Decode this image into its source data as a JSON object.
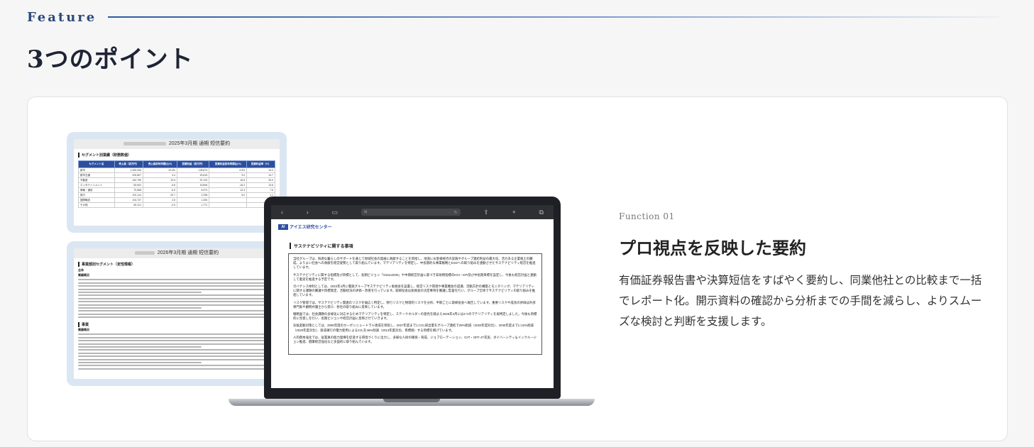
{
  "header": {
    "eyebrow": "Feature",
    "title": "3つのポイント"
  },
  "function": {
    "label": "Function 01",
    "title": "プロ視点を反映した要約",
    "description": "有価証券報告書や決算短信をすばやく要約し、同業他社との比較まで一括でレポート化。開示資料の確認から分析までの手間を減らし、よりスムーズな検討と判断を支援します。"
  },
  "doc_one": {
    "heading": "2025年3月期 通期 短信要約",
    "section": "セグメント別業績（財務数値）",
    "columns": [
      "セグメント名",
      "売上高（百万円）",
      "売上高前年同期比(%)",
      "営業利益（百万円）",
      "営業利益前年同期比(%)",
      "営業利益率（%）"
    ],
    "rows": [
      [
        "都市",
        "1,300,006",
        "10.9%",
        "128,879",
        "4.9%",
        "19.0"
      ],
      [
        "都市交通",
        "209,807",
        "3.4",
        "20,615",
        "3.0",
        "14.7"
      ],
      [
        "不動産",
        "162,799",
        "10.5",
        "57,129",
        "16.6",
        "25.0"
      ],
      [
        "エンタテインメント",
        "83,902",
        "-9.8",
        "15,896",
        "-16.2",
        "13.8"
      ],
      [
        "情報・通信",
        "70,668",
        "-6.9",
        "6,974",
        "12.3",
        "7.6"
      ],
      [
        "旅行",
        "201,114",
        "20.7",
        "2,298",
        "5.0",
        "1.1"
      ],
      [
        "国際輸送",
        "104,737",
        "2.6",
        "1,254",
        "",
        "1.2"
      ],
      [
        "その他",
        "60,121",
        "-0.9",
        "1,771",
        "",
        "2.9"
      ]
    ]
  },
  "doc_two": {
    "heading": "2026年3月期 通期 短信要約",
    "section": "事業部別セグメント（定性情報）",
    "sub1": "全体",
    "sub2": "業績概況",
    "sub3": "事業",
    "sub4": "業績概況"
  },
  "laptop": {
    "url": "ai",
    "logo_mark": "AI",
    "logo_text": "アイエス研究センター",
    "section_title": "サステナビリティに関する事項",
    "paragraphs": [
      "当社グループは、快適な暮らしのサポートを通じて地域社会の発展に貢献することを目指し、地道にお客様視点の実践やグループ連結利益の最大化、活力ある企業風土の醸成、よりよい社会への貢献を経営姿勢として取り組んでいます。マテリアリティを特定し、中長期的な事業戦略とESGへの取り組みを連動させたサステナビリティ経営を推進しています。",
      "サステナビリティに関する指標及び目標として、長期ビジョン「Vision2030」や中期経営計画に基づき非財務指標のKGI・KPI及び中長期目標を設定し、今後も経営計画と連動して着実を推進する予定です。",
      "ガバナンス体制としては、2022年4月に電鉄グループサステナビリティ委員会を設置し、経営リスク管理や事業機会の認識、活動方針の構築とモニタリング、マテリアリティに関する課題の審議や目標策定、活動状況の評価・改善を行っています。取締役会は委員会の決定事項を審議し監督を行い、グループ全体でサステナビリティの取り組みを推進しています。",
      "リスク管理では、サステナビリティ関連のリスクを幅広く特定し、移行リスクと物理的リスクを分析、半期ごとに取締役会へ報告しています。重要リスクや成長の評価は外部専門家や顧問弁護士から受け、各社の取り組みに反映しています。",
      "戦略面では、社会課題の多様化に対応するためマテリアリティを特定し、ステークホルダーの意見を踏まえ2025年3月には4つのマテリアリティを再特定しました。今後も目標的に見直しを行い、長期ビジョンや経営計画に反映させていきます。",
      "気候変動対策としては、2050年度のカーボンニュートラル達成を目指し、2027年度までにCO₂排出量をグループ連結で29%削減（2020年度対比）、2030年度までに42%削減（2020年度対比）、鉄道運行の電力使用によるCO₂を46%削減（2013年度対比、目標値）する目標を掲げています。",
      "人的資本強化では、従業員の能力発揮を促進する環境づくりに注力し、多様な人財の確保・育成、ジョブローテーション、OJT・OFF-JT充実、ダイバーシティ＆インクルージョン推進、健康経営強化など多面的に取り組んでいます。"
    ]
  }
}
